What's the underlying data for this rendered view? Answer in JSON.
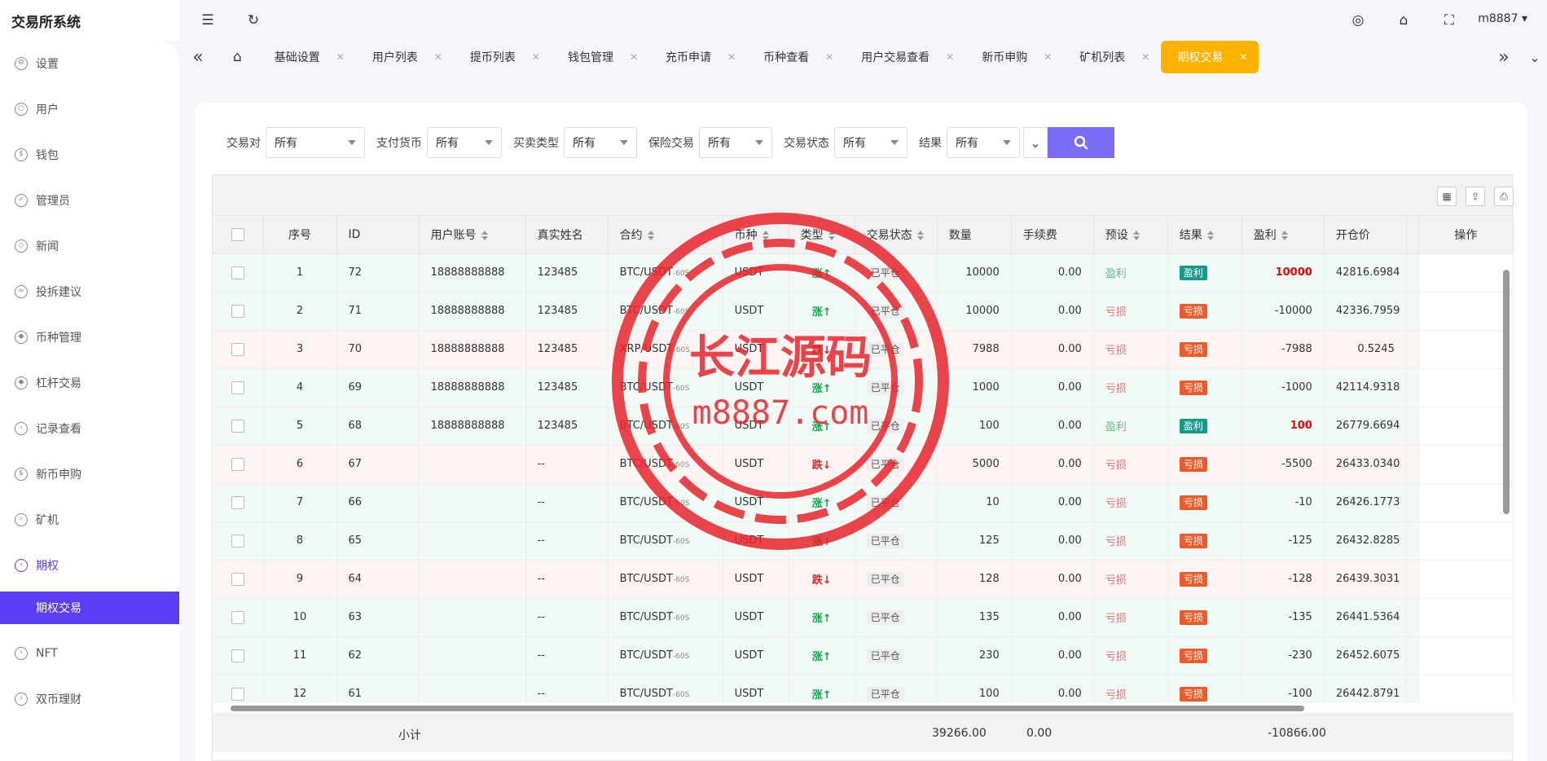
{
  "app": {
    "title": "交易所系统"
  },
  "topbar": {
    "user": "m8887"
  },
  "sidebar": {
    "items": [
      {
        "label": "设置",
        "icon": "gear-icon"
      },
      {
        "label": "用户",
        "icon": "user-icon"
      },
      {
        "label": "钱包",
        "icon": "dollar-icon"
      },
      {
        "label": "管理员",
        "icon": "shield-icon"
      },
      {
        "label": "新闻",
        "icon": "tag-icon"
      },
      {
        "label": "投拆建议",
        "icon": "link-icon"
      },
      {
        "label": "币种管理",
        "icon": "diamond-icon"
      },
      {
        "label": "杠杆交易",
        "icon": "diamond-icon"
      },
      {
        "label": "记录查看",
        "icon": "circle-arrow-icon"
      },
      {
        "label": "新币申购",
        "icon": "dollar-icon"
      },
      {
        "label": "矿机",
        "icon": "circle-arrow-icon"
      },
      {
        "label": "期权",
        "icon": "circle-arrow-icon"
      },
      {
        "label": "NFT",
        "icon": "circle-arrow-icon"
      },
      {
        "label": "双币理财",
        "icon": "circle-arrow-icon"
      }
    ],
    "active_sub": "期权交易"
  },
  "tabs": [
    "基础设置",
    "用户列表",
    "提币列表",
    "钱包管理",
    "充币申请",
    "币种查看",
    "用户交易查看",
    "新币申购",
    "矿机列表",
    "期权交易"
  ],
  "filters": [
    {
      "label": "交易对",
      "value": "所有"
    },
    {
      "label": "支付货币",
      "value": "所有"
    },
    {
      "label": "买卖类型",
      "value": "所有"
    },
    {
      "label": "保险交易",
      "value": "所有"
    },
    {
      "label": "交易状态",
      "value": "所有"
    },
    {
      "label": "结果",
      "value": "所有"
    }
  ],
  "table": {
    "headers": {
      "seq": "序号",
      "id": "ID",
      "account": "用户账号",
      "name": "真实姓名",
      "contract": "合约",
      "currency": "币种",
      "type": "类型",
      "status": "交易状态",
      "qty": "数量",
      "fee": "手续费",
      "preset": "预设",
      "result": "结果",
      "profit": "盈利",
      "open_price": "开仓价",
      "op": "操作"
    },
    "rows": [
      {
        "seq": "1",
        "id": "72",
        "account": "18888888888",
        "name": "123485",
        "pair": "BTC/USDT",
        "period": "-60S",
        "currency": "USDT",
        "dir": "up",
        "dir_text": "涨↑",
        "status": "已平仓",
        "qty": "10000",
        "fee": "0.00",
        "preset": "盈利",
        "result": "盈利",
        "profit": "10000",
        "open_price": "42816.6984"
      },
      {
        "seq": "2",
        "id": "71",
        "account": "18888888888",
        "name": "123485",
        "pair": "BTC/USDT",
        "period": "-60S",
        "currency": "USDT",
        "dir": "up",
        "dir_text": "涨↑",
        "status": "已平仓",
        "qty": "10000",
        "fee": "0.00",
        "preset": "亏损",
        "result": "亏损",
        "profit": "-10000",
        "open_price": "42336.7959"
      },
      {
        "seq": "3",
        "id": "70",
        "account": "18888888888",
        "name": "123485",
        "pair": "XRP/USDT",
        "period": "-60S",
        "currency": "USDT",
        "dir": "down",
        "dir_text": "跌↓",
        "status": "已平仓",
        "qty": "7988",
        "fee": "0.00",
        "preset": "亏损",
        "result": "亏损",
        "profit": "-7988",
        "open_price": "0.5245"
      },
      {
        "seq": "4",
        "id": "69",
        "account": "18888888888",
        "name": "123485",
        "pair": "BTC/USDT",
        "period": "-60S",
        "currency": "USDT",
        "dir": "up",
        "dir_text": "涨↑",
        "status": "已平仓",
        "qty": "1000",
        "fee": "0.00",
        "preset": "亏损",
        "result": "亏损",
        "profit": "-1000",
        "open_price": "42114.9318"
      },
      {
        "seq": "5",
        "id": "68",
        "account": "18888888888",
        "name": "123485",
        "pair": "BTC/USDT",
        "period": "-60S",
        "currency": "USDT",
        "dir": "up",
        "dir_text": "涨↑",
        "status": "已平仓",
        "qty": "100",
        "fee": "0.00",
        "preset": "盈利",
        "result": "盈利",
        "profit": "100",
        "open_price": "26779.6694"
      },
      {
        "seq": "6",
        "id": "67",
        "account": "",
        "name": "--",
        "pair": "BTC/USDT",
        "period": "-60S",
        "currency": "USDT",
        "dir": "down",
        "dir_text": "跌↓",
        "status": "已平仓",
        "qty": "5000",
        "fee": "0.00",
        "preset": "亏损",
        "result": "亏损",
        "profit": "-5500",
        "open_price": "26433.0340"
      },
      {
        "seq": "7",
        "id": "66",
        "account": "",
        "name": "--",
        "pair": "BTC/USDT",
        "period": "-60S",
        "currency": "USDT",
        "dir": "up",
        "dir_text": "涨↑",
        "status": "已平仓",
        "qty": "10",
        "fee": "0.00",
        "preset": "亏损",
        "result": "亏损",
        "profit": "-10",
        "open_price": "26426.1773"
      },
      {
        "seq": "8",
        "id": "65",
        "account": "",
        "name": "--",
        "pair": "BTC/USDT",
        "period": "-60S",
        "currency": "USDT",
        "dir": "up",
        "dir_text": "涨↑",
        "status": "已平仓",
        "qty": "125",
        "fee": "0.00",
        "preset": "亏损",
        "result": "亏损",
        "profit": "-125",
        "open_price": "26432.8285"
      },
      {
        "seq": "9",
        "id": "64",
        "account": "",
        "name": "--",
        "pair": "BTC/USDT",
        "period": "-60S",
        "currency": "USDT",
        "dir": "down",
        "dir_text": "跌↓",
        "status": "已平仓",
        "qty": "128",
        "fee": "0.00",
        "preset": "亏损",
        "result": "亏损",
        "profit": "-128",
        "open_price": "26439.3031"
      },
      {
        "seq": "10",
        "id": "63",
        "account": "",
        "name": "--",
        "pair": "BTC/USDT",
        "period": "-60S",
        "currency": "USDT",
        "dir": "up",
        "dir_text": "涨↑",
        "status": "已平仓",
        "qty": "135",
        "fee": "0.00",
        "preset": "亏损",
        "result": "亏损",
        "profit": "-135",
        "open_price": "26441.5364"
      },
      {
        "seq": "11",
        "id": "62",
        "account": "",
        "name": "--",
        "pair": "BTC/USDT",
        "period": "-60S",
        "currency": "USDT",
        "dir": "up",
        "dir_text": "涨↑",
        "status": "已平仓",
        "qty": "230",
        "fee": "0.00",
        "preset": "亏损",
        "result": "亏损",
        "profit": "-230",
        "open_price": "26452.6075"
      },
      {
        "seq": "12",
        "id": "61",
        "account": "",
        "name": "--",
        "pair": "BTC/USDT",
        "period": "-60S",
        "currency": "USDT",
        "dir": "up",
        "dir_text": "涨↑",
        "status": "已平仓",
        "qty": "100",
        "fee": "0.00",
        "preset": "亏损",
        "result": "亏损",
        "profit": "-100",
        "open_price": "26442.8791"
      }
    ],
    "summary": {
      "label": "小计",
      "qty": "39266.00",
      "fee": "0.00",
      "profit": "-10866.00"
    }
  },
  "watermark": {
    "line1": "长江源码",
    "line2": "m8887.com",
    "color": "#e8232a"
  },
  "colors": {
    "accent": "#5b3df5",
    "tab_active": "#fdb100",
    "search_button": "#7b6cf6"
  }
}
